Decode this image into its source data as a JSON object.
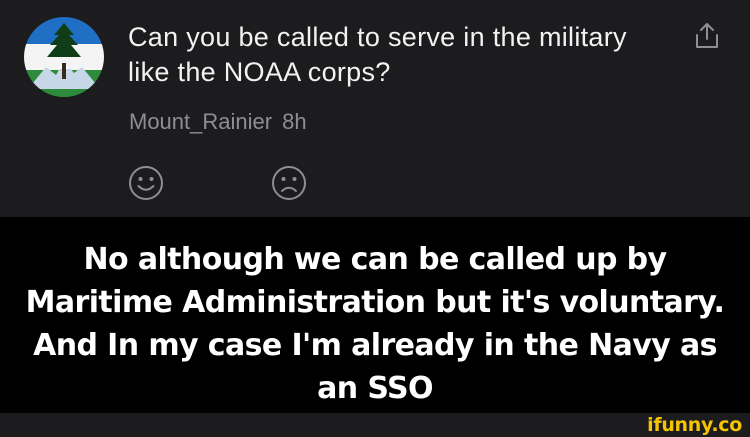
{
  "post": {
    "title": "Can you be called to serve in the military like the NOAA corps?",
    "author": "Mount_Rainier",
    "time": "8h",
    "icons": {
      "avatar": "cascadia-flag-avatar",
      "share": "share-icon",
      "upvote": "smiley-face-icon",
      "downvote": "frowny-face-icon"
    }
  },
  "caption": {
    "text": "No although we can be called up by Maritime Administration but it's voluntary. And In my case I'm already in the Navy as an SSO"
  },
  "watermark": {
    "text": "ifunny.co"
  },
  "colors": {
    "card_background": "#1c1c1e",
    "caption_background": "#000000",
    "meta_text": "#8e8e93",
    "watermark": "#f5c400"
  }
}
